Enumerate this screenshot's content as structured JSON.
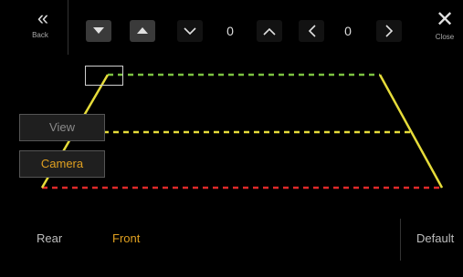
{
  "header": {
    "back_label": "Back",
    "back_icon": "«",
    "close_label": "Close",
    "close_icon": "✕",
    "vertical_value": "0",
    "horizontal_value": "0"
  },
  "side_buttons": {
    "view_label": "View",
    "camera_label": "Camera"
  },
  "bottom_bar": {
    "rear_label": "Rear",
    "front_label": "Front",
    "default_label": "Default"
  },
  "colors": {
    "accent": "#e0a020",
    "guide_green": "#7cc242",
    "guide_yellow": "#e6dc3a",
    "guide_red": "#e02a2a"
  }
}
